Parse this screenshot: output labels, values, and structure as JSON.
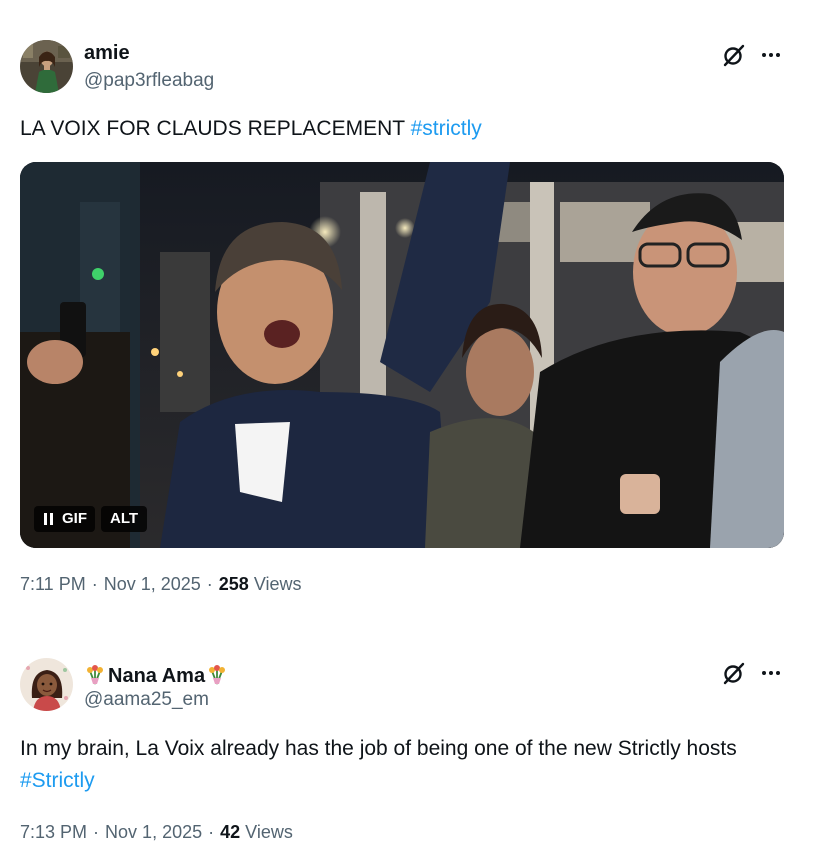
{
  "tweets": [
    {
      "display_name": "amie",
      "handle": "@pap3rfleabag",
      "text": "LA VOIX FOR CLAUDS REPLACEMENT",
      "hashtag": "#strictly",
      "media": {
        "type": "GIF",
        "pause_icon": "pause-icon",
        "gif_label": "GIF",
        "alt_label": "ALT"
      },
      "time": "7:11 PM",
      "separator": "·",
      "date": "Nov 1, 2025",
      "views_count": "258",
      "views_label": "Views"
    },
    {
      "display_name": "Nana Ama",
      "name_emoji": "tulip-bouquet-emoji",
      "handle": "@aama25_em",
      "text": "In my brain, La Voix already has the job of being one of the new Strictly hosts",
      "hashtag": "#Strictly",
      "time": "7:13 PM",
      "separator": "·",
      "date": "Nov 1, 2025",
      "views_count": "42",
      "views_label": "Views"
    }
  ],
  "icons": {
    "grok": "grok-icon",
    "more": "more-options-icon"
  },
  "colors": {
    "text": "#0f1419",
    "secondary": "#536471",
    "link": "#1d9bf0",
    "background": "#ffffff"
  }
}
